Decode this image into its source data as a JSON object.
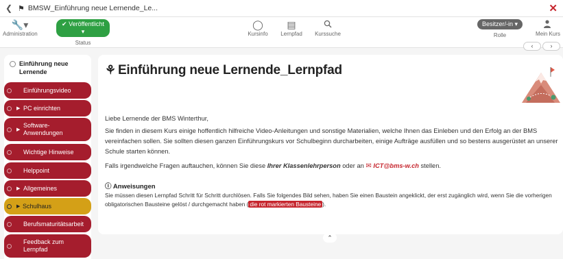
{
  "topbar": {
    "back_icon": "chevron-left-icon",
    "home_icon": "home-icon",
    "title": "BMSW_Einführung neue Lernende_Le...",
    "close_icon": "close-icon"
  },
  "toolbar": {
    "administration": {
      "icon": "wrench-icon",
      "label": "Administration"
    },
    "status": {
      "value": "✔ Veröffentlicht ▾",
      "label": "Status"
    },
    "kursinfo": {
      "icon": "lightbulb-icon",
      "label": "Kursinfo"
    },
    "lernpfad": {
      "icon": "signpost-icon",
      "label": "Lernpfad"
    },
    "kurssuche": {
      "icon": "search-icon",
      "label": "Kurssuche"
    },
    "rolle": {
      "value": "Besitzer/-in ▾",
      "label": "Rolle"
    },
    "mein_kurs": {
      "icon": "user-icon",
      "label": "Mein Kurs"
    }
  },
  "nav": {
    "prev": "‹",
    "next": "›"
  },
  "sidebar": {
    "root": "Einführung neue Lernende",
    "items": [
      {
        "label": "Einführungsvideo",
        "has_children": false,
        "active": false
      },
      {
        "label": "PC einrichten",
        "has_children": true,
        "active": false
      },
      {
        "label": "Software-Anwendungen",
        "has_children": true,
        "active": false
      },
      {
        "label": "Wichtige Hinweise",
        "has_children": false,
        "active": false
      },
      {
        "label": "Helppoint",
        "has_children": false,
        "active": false
      },
      {
        "label": "Allgemeines",
        "has_children": true,
        "active": false
      },
      {
        "label": "Schulhaus",
        "has_children": true,
        "active": true
      },
      {
        "label": "Berufsmaturitätsarbeit",
        "has_children": false,
        "active": false
      },
      {
        "label": "Feedback zum Lernpfad",
        "has_children": false,
        "active": false
      }
    ]
  },
  "main": {
    "title_icon": "tree-structure-icon",
    "title": "Einführung neue Lernende_Lernpfad",
    "greeting": "Liebe Lernende der BMS Winterthur,",
    "intro": "Sie finden in diesem Kurs einige hoffentlich hilfreiche Video-Anleitungen und sonstige Materialien, welche Ihnen das Einleben und den Erfolg an der BMS vereinfachen sollen. Sie sollten diesen ganzen Einführungskurs vor Schulbeginn durcharbeiten, einige Aufträge ausfüllen und so bestens ausgerüstet an unserer Schule starten können.",
    "questions_prefix": "Falls irgendwelche Fragen auftauchen, können Sie diese ",
    "questions_bold": "Ihrer Klassenlehrperson",
    "questions_mid": " oder an ",
    "email_icon": "envelope-icon",
    "email": "ICT@bms-w.ch",
    "questions_suffix": " stellen.",
    "section_icon": "info-icon",
    "section_title": "Anweisungen",
    "instructions_prefix": "Sie müssen diesen Lernpfad Schritt für Schritt durchlösen. Falls Sie folgendes Bild sehen, haben Sie einen Baustein angeklickt, der erst zugänglich wird, wenn Sie die vorherigen obligatorischen Bausteine gelöst / durchgemacht haben (",
    "instructions_highlight": "die rot markierten Bausteine",
    "instructions_suffix": ").",
    "collapse_icon": "chevron-up-icon"
  },
  "colors": {
    "accent_red": "#a51d2d",
    "active_yellow": "#d4a017",
    "status_green": "#2ea043",
    "link_red": "#c6262e"
  }
}
